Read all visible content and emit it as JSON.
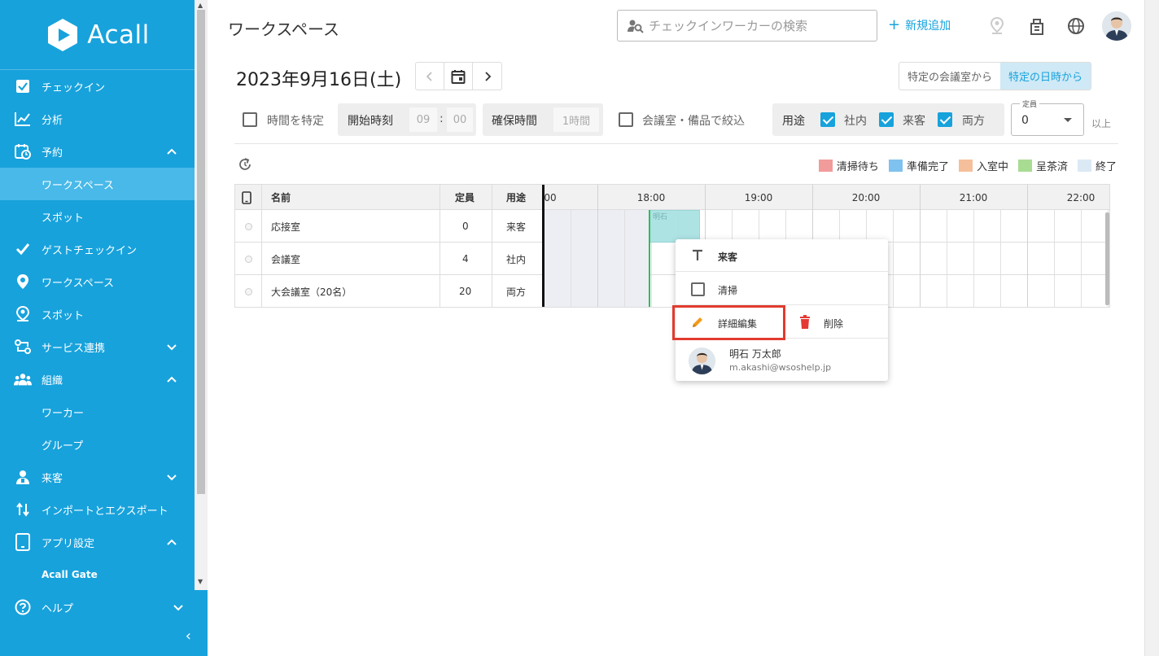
{
  "brand": {
    "name": "Acall"
  },
  "sidebar": {
    "items": [
      {
        "label": "チェックイン"
      },
      {
        "label": "分析"
      },
      {
        "label": "予約"
      },
      {
        "label": "ワークスペース"
      },
      {
        "label": "スポット"
      },
      {
        "label": "ゲストチェックイン"
      },
      {
        "label": "ワークスペース"
      },
      {
        "label": "スポット"
      },
      {
        "label": "サービス連携"
      },
      {
        "label": "組織"
      },
      {
        "label": "ワーカー"
      },
      {
        "label": "グループ"
      },
      {
        "label": "来客"
      },
      {
        "label": "インポートとエクスポート"
      },
      {
        "label": "アプリ設定"
      },
      {
        "label": "Acall Gate"
      },
      {
        "label": "ヘルプ"
      }
    ]
  },
  "header": {
    "title": "ワークスペース",
    "search_placeholder": "チェックインワーカーの検索",
    "add_label": "新規追加"
  },
  "date": {
    "label": "2023年9月16日(土)"
  },
  "view_toggle": {
    "left": "特定の会議室から",
    "right": "特定の日時から",
    "selected": "right"
  },
  "filters": {
    "specify_time_label": "時間を特定",
    "start_time_label": "開始時刻",
    "start_hour": "09",
    "start_sep": ":",
    "start_min": "00",
    "duration_label": "確保時間",
    "duration_value": "1時間",
    "equipment_label": "会議室・備品で絞込",
    "purpose_label": "用途",
    "purpose_options": [
      {
        "label": "社内",
        "checked": true
      },
      {
        "label": "来客",
        "checked": true
      },
      {
        "label": "両方",
        "checked": true
      }
    ],
    "capacity_legend": "定員",
    "capacity_value": "0",
    "capacity_unit": "以上"
  },
  "legend": [
    {
      "label": "清掃待ち",
      "color": "#f19b9b"
    },
    {
      "label": "準備完了",
      "color": "#7fc1ef"
    },
    {
      "label": "入室中",
      "color": "#f5bf9b"
    },
    {
      "label": "呈茶済",
      "color": "#a8dc93"
    },
    {
      "label": "終了",
      "color": "#dbe9f5"
    }
  ],
  "table": {
    "headers": {
      "name": "名前",
      "capacity": "定員",
      "purpose": "用途"
    },
    "hours": [
      "00",
      "18:00",
      "19:00",
      "20:00",
      "21:00",
      "22:00"
    ],
    "rows": [
      {
        "name": "応接室",
        "capacity": "0",
        "purpose": "来客"
      },
      {
        "name": "会議室",
        "capacity": "4",
        "purpose": "社内"
      },
      {
        "name": "大会議室（20名）",
        "capacity": "20",
        "purpose": "両方"
      }
    ],
    "booking_text": "明石"
  },
  "popup": {
    "title": "来客",
    "cleaning": "清掃",
    "edit": "詳細編集",
    "delete": "削除",
    "user_name": "明石 万太郎",
    "user_email": "m.akashi@wsoshelp.jp"
  },
  "colors": {
    "accent": "#17a2dc",
    "highlight": "#e23b2e",
    "delete": "#e53935",
    "edit": "#f29b1a"
  }
}
